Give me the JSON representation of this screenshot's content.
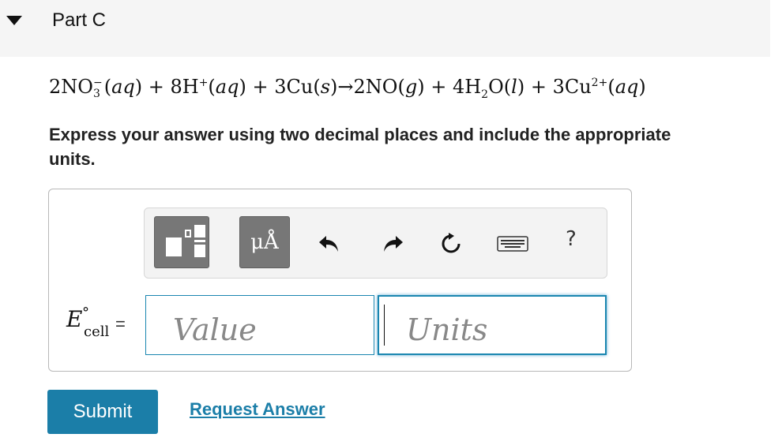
{
  "part": {
    "title": "Part C",
    "collapse_icon": "caret-down-icon"
  },
  "equation": {
    "t1": "2NO",
    "no3_sub": "3",
    "no3_sup": "−",
    "aq": "aq",
    "plus": " + ",
    "h": "8H",
    "h_sup": "+",
    "cu": "3Cu",
    "s": "s",
    "arrow": "→",
    "no": "2NO",
    "g": "g",
    "water": "4H",
    "water_sub": "2",
    "o": "O",
    "l": "l",
    "cu2": "3Cu",
    "cu2_sup": "2+"
  },
  "instruction": "Express your answer using two decimal places and include the appropriate units.",
  "toolbar": {
    "units_label": "μÅ",
    "icons": [
      "templates-icon",
      "units-icon",
      "undo-icon",
      "redo-icon",
      "reset-icon",
      "keyboard-icon",
      "help-icon"
    ],
    "help_label": "?"
  },
  "answer": {
    "label_E": "E",
    "label_sup": "°",
    "label_sub": "cell",
    "equals": "=",
    "value_placeholder": "Value",
    "units_placeholder": "Units"
  },
  "actions": {
    "submit_label": "Submit",
    "request_label": "Request Answer"
  },
  "colors": {
    "accent": "#1b7ea8",
    "toolbar_button": "#777777",
    "header_bg": "#f5f5f5"
  }
}
